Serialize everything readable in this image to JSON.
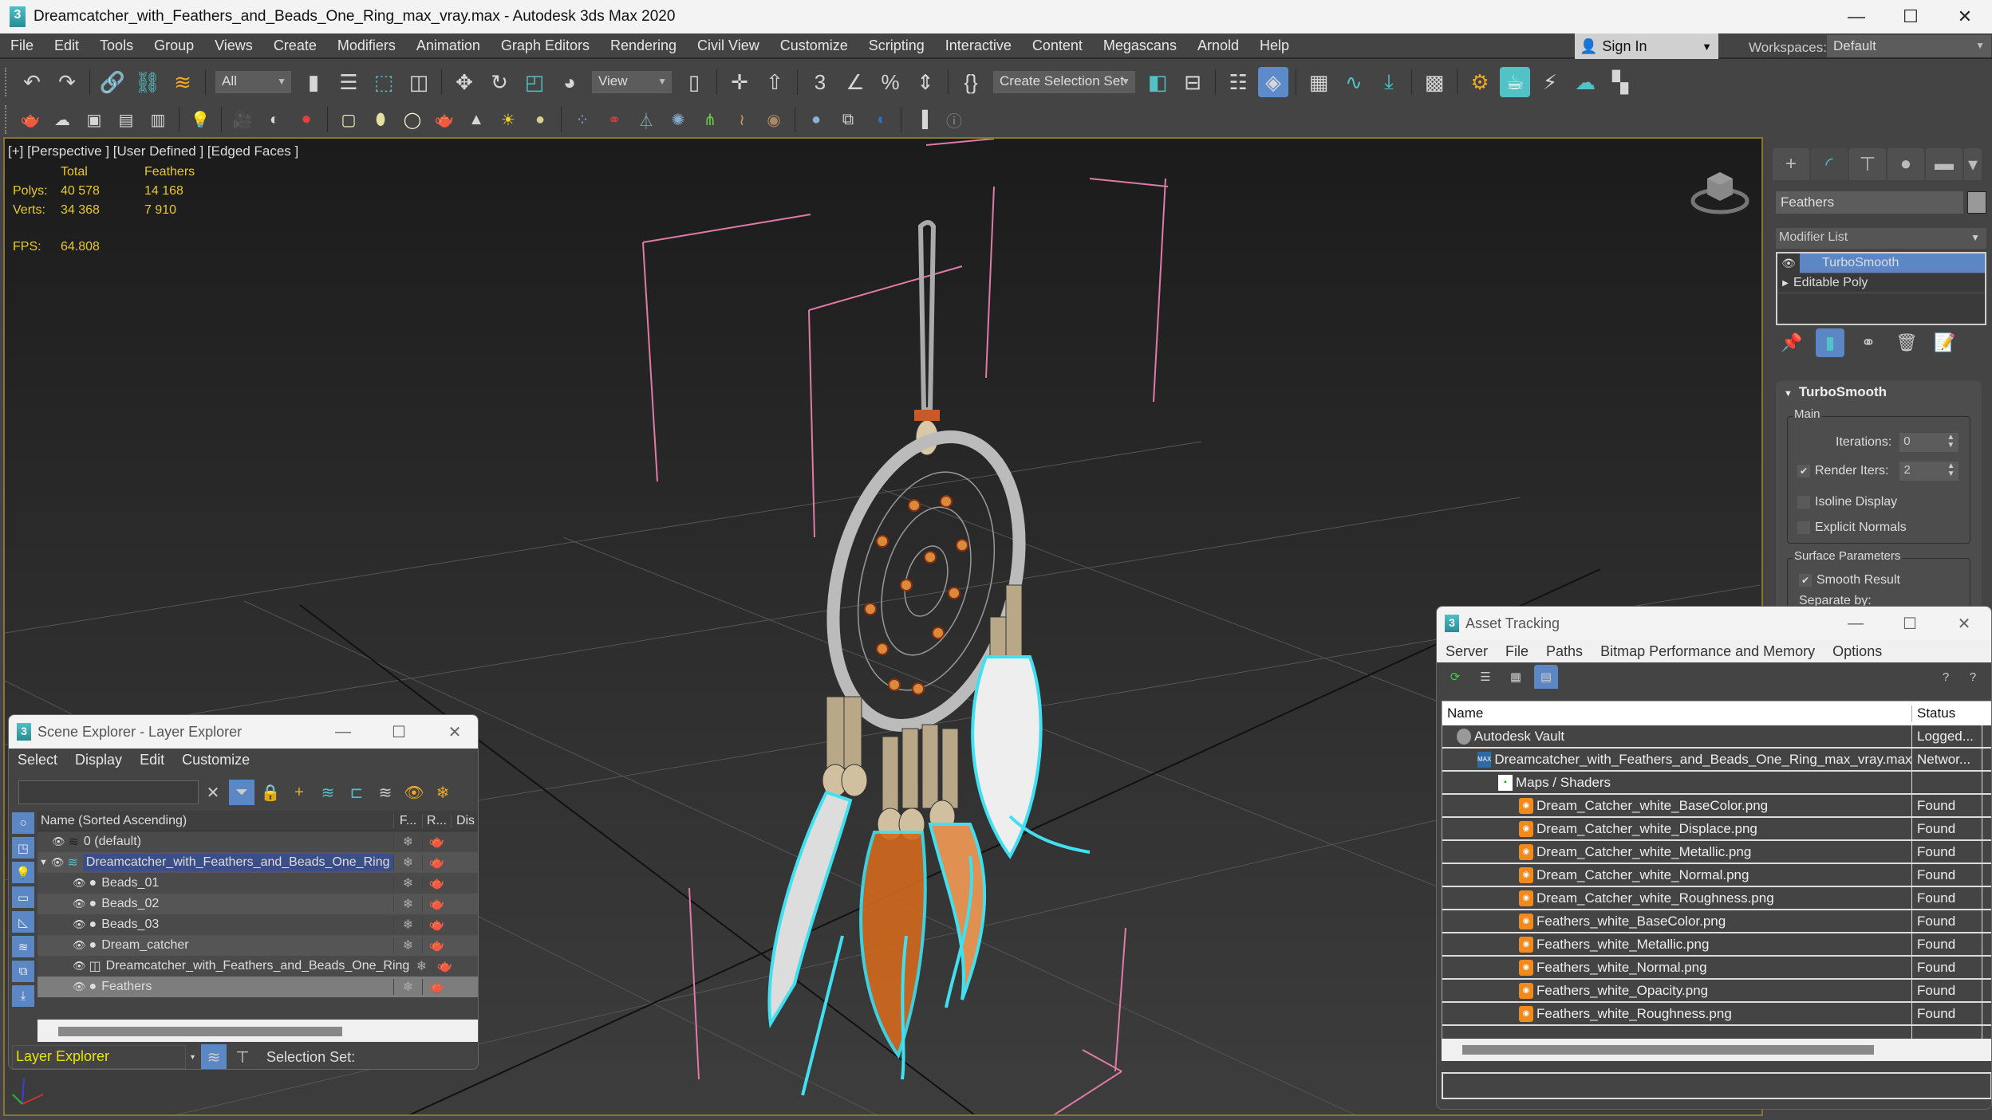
{
  "window": {
    "title": "Dreamcatcher_with_Feathers_and_Beads_One_Ring_max_vray.max - Autodesk 3ds Max 2020",
    "app_icon": "3"
  },
  "menubar": {
    "items": [
      "File",
      "Edit",
      "Tools",
      "Group",
      "Views",
      "Create",
      "Modifiers",
      "Animation",
      "Graph Editors",
      "Rendering",
      "Civil View",
      "Customize",
      "Scripting",
      "Interactive",
      "Content",
      "Megascans",
      "Arnold",
      "Help"
    ],
    "sign_in": "Sign In",
    "workspaces_label": "Workspaces:",
    "workspace_value": "Default"
  },
  "toolbar": {
    "selection_filter": "All",
    "ref_coord": "View",
    "selection_set": "Create Selection Set"
  },
  "viewport": {
    "label": "[+] [Perspective ] [User Defined ] [Edged Faces ]",
    "stats": {
      "col_total": "Total",
      "col_selected": "Feathers",
      "polys_label": "Polys:",
      "polys_total": "40 578",
      "polys_selected": "14 168",
      "verts_label": "Verts:",
      "verts_total": "34 368",
      "verts_selected": "7 910",
      "fps_label": "FPS:",
      "fps_value": "64.808"
    },
    "colors": {
      "stat_text": "#e8c92c",
      "selection_outline": "#40e0f0",
      "helper_lines": "#e07aa8"
    }
  },
  "command_panel": {
    "object_name": "Feathers",
    "modifier_list_label": "Modifier List",
    "stack": [
      {
        "label": "TurboSmooth",
        "selected": true
      },
      {
        "label": "Editable Poly",
        "selected": false
      }
    ],
    "rollout": {
      "title": "TurboSmooth",
      "main_group": "Main",
      "iterations_label": "Iterations:",
      "iterations_value": "0",
      "render_iters_label": "Render Iters:",
      "render_iters_value": "2",
      "render_iters_checked": true,
      "isoline_label": "Isoline Display",
      "isoline_checked": false,
      "explicit_normals_label": "Explicit Normals",
      "explicit_normals_checked": false,
      "surface_group": "Surface Parameters",
      "smooth_result_label": "Smooth Result",
      "smooth_result_checked": true,
      "separate_by_label": "Separate by:"
    }
  },
  "scene_explorer": {
    "title": "Scene Explorer - Layer Explorer",
    "menu": [
      "Select",
      "Display",
      "Edit",
      "Customize"
    ],
    "search_value": "",
    "columns": {
      "name": "Name (Sorted Ascending)",
      "c1": "F...",
      "c2": "R...",
      "c3": "Dis"
    },
    "rows": [
      {
        "name": "0 (default)",
        "level": 0,
        "type": "layer",
        "selected": false
      },
      {
        "name": "Dreamcatcher_with_Feathers_and_Beads_One_Ring",
        "level": 0,
        "type": "layer-active",
        "expanded": true,
        "selected": false,
        "highlight": true
      },
      {
        "name": "Beads_01",
        "level": 1,
        "type": "object",
        "selected": false
      },
      {
        "name": "Beads_02",
        "level": 1,
        "type": "object",
        "selected": false
      },
      {
        "name": "Beads_03",
        "level": 1,
        "type": "object",
        "selected": false
      },
      {
        "name": "Dream_catcher",
        "level": 1,
        "type": "object",
        "selected": false
      },
      {
        "name": "Dreamcatcher_with_Feathers_and_Beads_One_Ring",
        "level": 1,
        "type": "group",
        "selected": false
      },
      {
        "name": "Feathers",
        "level": 1,
        "type": "object",
        "selected": true
      }
    ],
    "explorer_type": "Layer Explorer",
    "selection_set_label": "Selection Set:"
  },
  "asset_tracking": {
    "title": "Asset Tracking",
    "menu": [
      "Server",
      "File",
      "Paths",
      "Bitmap Performance and Memory",
      "Options"
    ],
    "columns": {
      "name": "Name",
      "status": "Status"
    },
    "rows": [
      {
        "name": "Autodesk Vault",
        "status": "Logged...",
        "level": 0,
        "icon": "vault"
      },
      {
        "name": "Dreamcatcher_with_Feathers_and_Beads_One_Ring_max_vray.max",
        "status": "Networ...",
        "level": 1,
        "icon": "max"
      },
      {
        "name": "Maps / Shaders",
        "status": "",
        "level": 2,
        "icon": "maps"
      },
      {
        "name": "Dream_Catcher_white_BaseColor.png",
        "status": "Found",
        "level": 3,
        "icon": "png"
      },
      {
        "name": "Dream_Catcher_white_Displace.png",
        "status": "Found",
        "level": 3,
        "icon": "png"
      },
      {
        "name": "Dream_Catcher_white_Metallic.png",
        "status": "Found",
        "level": 3,
        "icon": "png"
      },
      {
        "name": "Dream_Catcher_white_Normal.png",
        "status": "Found",
        "level": 3,
        "icon": "png"
      },
      {
        "name": "Dream_Catcher_white_Roughness.png",
        "status": "Found",
        "level": 3,
        "icon": "png"
      },
      {
        "name": "Feathers_white_BaseColor.png",
        "status": "Found",
        "level": 3,
        "icon": "png"
      },
      {
        "name": "Feathers_white_Metallic.png",
        "status": "Found",
        "level": 3,
        "icon": "png"
      },
      {
        "name": "Feathers_white_Normal.png",
        "status": "Found",
        "level": 3,
        "icon": "png"
      },
      {
        "name": "Feathers_white_Opacity.png",
        "status": "Found",
        "level": 3,
        "icon": "png"
      },
      {
        "name": "Feathers_white_Roughness.png",
        "status": "Found",
        "level": 3,
        "icon": "png"
      },
      {
        "name": "",
        "status": "",
        "level": 0,
        "icon": ""
      }
    ]
  }
}
